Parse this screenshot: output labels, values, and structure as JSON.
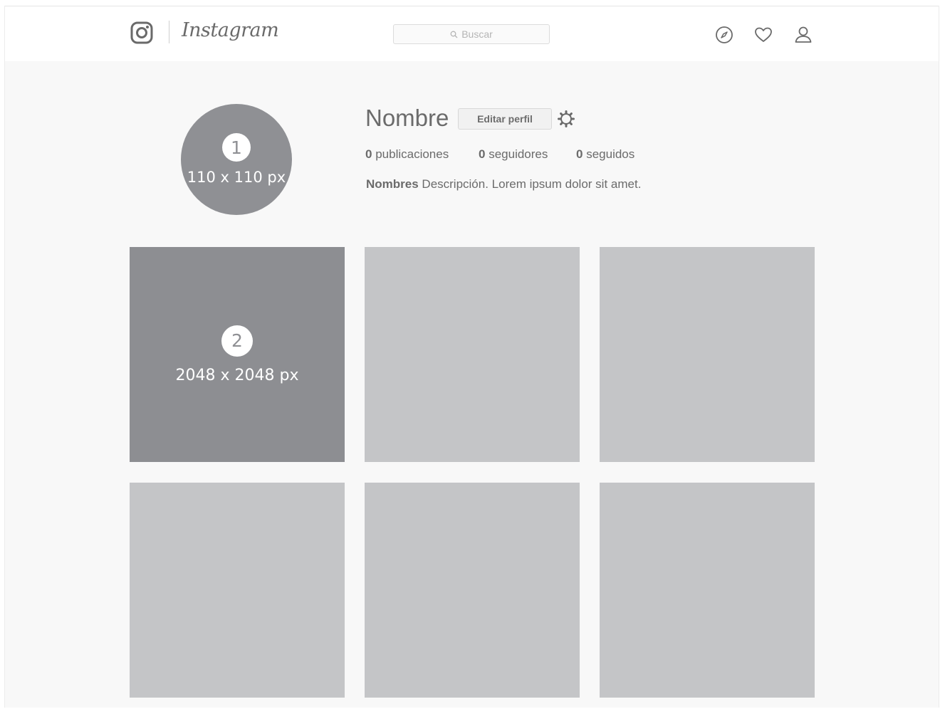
{
  "header": {
    "app_name": "Instagram",
    "search_placeholder": "Buscar",
    "icons": [
      "instagram-camera-icon",
      "compass-icon",
      "heart-icon",
      "user-icon"
    ]
  },
  "profile": {
    "avatar_badge": "1",
    "avatar_dimensions": "110 x 110 px",
    "name": "Nombre",
    "edit_button": "Editar perfil",
    "stats": [
      {
        "count": "0",
        "label": "publicaciones"
      },
      {
        "count": "0",
        "label": "seguidores"
      },
      {
        "count": "0",
        "label": "seguidos"
      }
    ],
    "bio_name": "Nombres",
    "bio_text": " Descripción. Lorem ipsum dolor sit amet."
  },
  "grid": {
    "featured_badge": "2",
    "featured_dimensions": "2048 x 2048 px"
  },
  "colors": {
    "placeholder_dark": "#8d8e92",
    "placeholder_light": "#c4c5c7",
    "background": "#f8f8f8"
  }
}
